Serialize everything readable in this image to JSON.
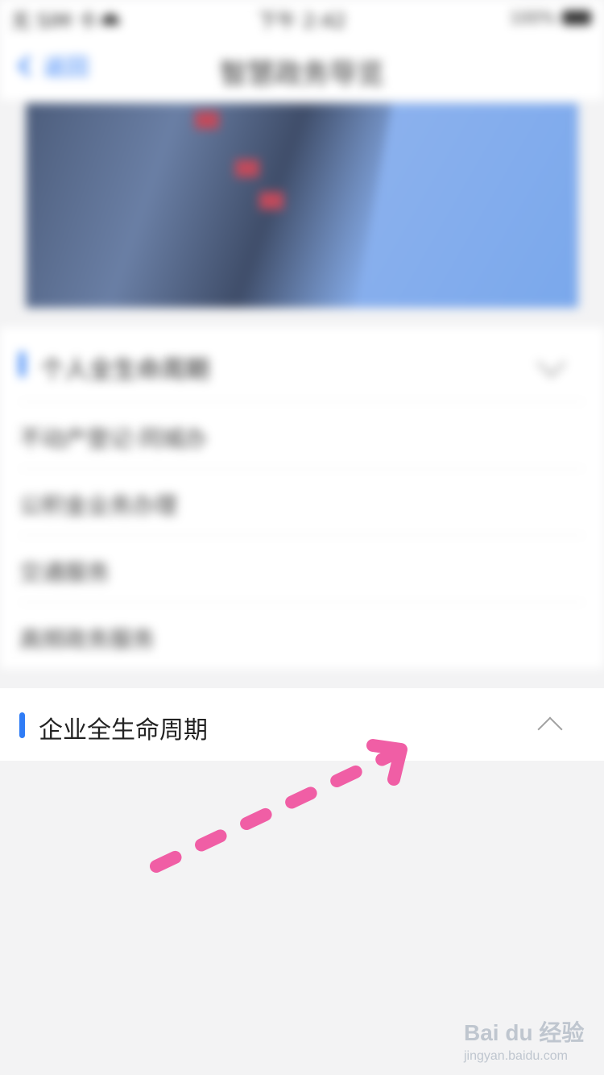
{
  "status_bar": {
    "carrier": "无 SIM 卡",
    "time": "下午 2:42",
    "battery_text": "100%"
  },
  "nav": {
    "back_label": "返回",
    "title": "智慧政务导览"
  },
  "card": {
    "title": "个人全生命周期",
    "items": [
      {
        "label": "不动产登记·同城办"
      },
      {
        "label": "公积金业务办理"
      },
      {
        "label": "交通服务"
      },
      {
        "label": "高频政务服务"
      }
    ]
  },
  "section": {
    "title": "企业全生命周期"
  },
  "watermark": {
    "brand": "Bai du 经验",
    "url": "jingyan.baidu.com"
  },
  "colors": {
    "accent": "#2f7cf6",
    "annotation": "#f05ea5"
  }
}
